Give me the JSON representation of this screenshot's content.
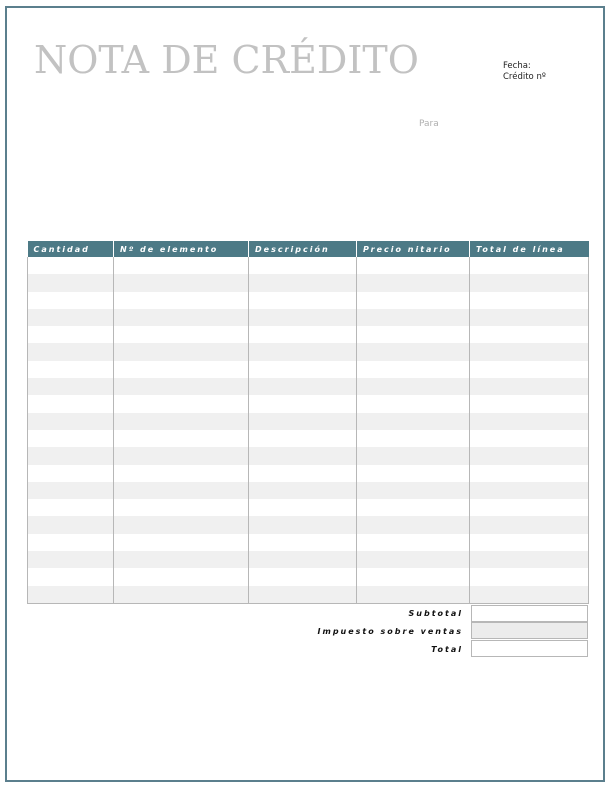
{
  "document": {
    "title": "NOTA DE CRÉDITO",
    "fecha_label": "Fecha:",
    "credito_label": "Crédito nº",
    "para_label": "Para"
  },
  "table": {
    "headers": [
      "Cantidad",
      "Nº de elemento",
      "Descripción",
      "Precio nitario",
      "Total de línea"
    ],
    "row_count": 20
  },
  "totals": {
    "subtotal_label": "Subtotal",
    "tax_label": "Impuesto sobre ventas",
    "total_label": "Total"
  },
  "colors": {
    "accent": "#4d7a86",
    "frame": "#5b7f8d",
    "title": "#c2c2c2"
  }
}
